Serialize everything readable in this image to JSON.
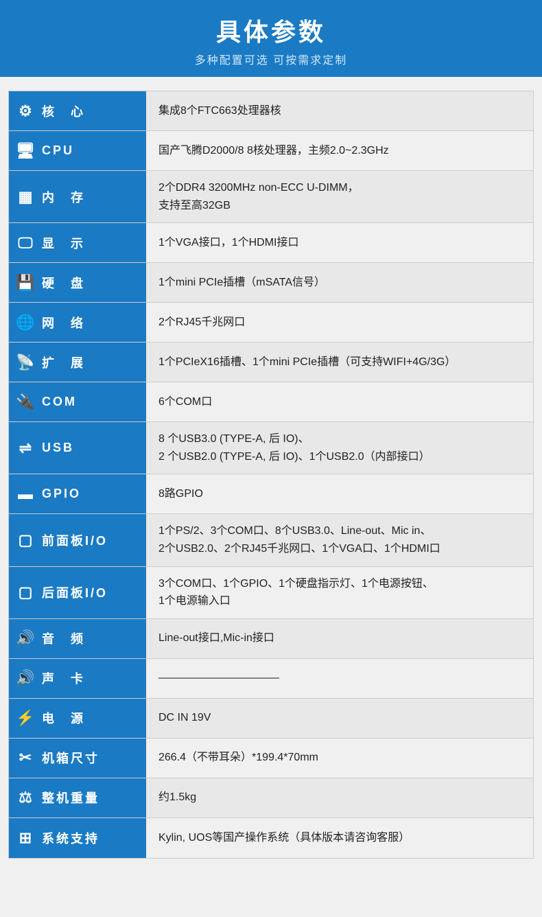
{
  "header": {
    "title": "具体参数",
    "subtitle": "多种配置可选 可按需求定制"
  },
  "rows": [
    {
      "id": "core",
      "icon": "⚙",
      "label": "核　心",
      "value": "集成8个FTC663处理器核"
    },
    {
      "id": "cpu",
      "icon": "🖥",
      "label": "CPU",
      "value": "国产飞腾D2000/8  8核处理器，主频2.0~2.3GHz"
    },
    {
      "id": "memory",
      "icon": "▦",
      "label": "内　存",
      "value": "2个DDR4 3200MHz non-ECC U-DIMM，\n支持至高32GB"
    },
    {
      "id": "display",
      "icon": "🖵",
      "label": "显　示",
      "value": "1个VGA接口，1个HDMI接口"
    },
    {
      "id": "harddisk",
      "icon": "💾",
      "label": "硬　盘",
      "value": "1个mini PCIe插槽（mSATA信号）"
    },
    {
      "id": "network",
      "icon": "🌐",
      "label": "网　络",
      "value": "2个RJ45千兆网口"
    },
    {
      "id": "expansion",
      "icon": "📡",
      "label": "扩　展",
      "value": "1个PCIeX16插槽、1个mini PCIe插槽（可支持WIFI+4G/3G）"
    },
    {
      "id": "com",
      "icon": "🔌",
      "label": "COM",
      "value": "6个COM口"
    },
    {
      "id": "usb",
      "icon": "⇌",
      "label": "USB",
      "value": "8 个USB3.0 (TYPE-A, 后 IO)、\n2 个USB2.0 (TYPE-A, 后 IO)、1个USB2.0（内部接口）"
    },
    {
      "id": "gpio",
      "icon": "▬",
      "label": "GPIO",
      "value": "8路GPIO"
    },
    {
      "id": "front-panel",
      "icon": "▢",
      "label": "前面板I/O",
      "value": "1个PS/2、3个COM口、8个USB3.0、Line-out、Mic in、\n2个USB2.0、2个RJ45千兆网口、1个VGA口、1个HDMI口"
    },
    {
      "id": "rear-panel",
      "icon": "▢",
      "label": "后面板I/O",
      "value": "3个COM口、1个GPIO、1个硬盘指示灯、1个电源按钮、\n1个电源输入口"
    },
    {
      "id": "audio",
      "icon": "🔊",
      "label": "音　频",
      "value": "Line-out接口,Mic-in接口"
    },
    {
      "id": "soundcard",
      "icon": "🔊",
      "label": "声　卡",
      "value": "———————————"
    },
    {
      "id": "power",
      "icon": "⚡",
      "label": "电　源",
      "value": "DC IN 19V"
    },
    {
      "id": "chassis",
      "icon": "✂",
      "label": "机箱尺寸",
      "value": "266.4（不带耳朵）*199.4*70mm"
    },
    {
      "id": "weight",
      "icon": "⚖",
      "label": "整机重量",
      "value": "约1.5kg"
    },
    {
      "id": "os",
      "icon": "⊞",
      "label": "系统支持",
      "value": "Kylin, UOS等国产操作系统（具体版本请咨询客服）"
    }
  ]
}
